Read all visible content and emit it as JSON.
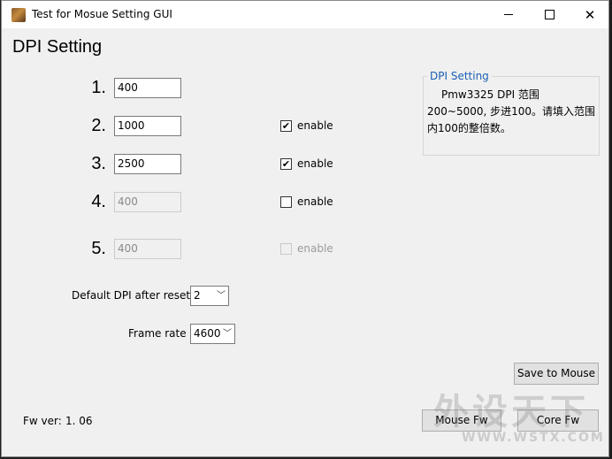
{
  "window": {
    "title": "Test for Mosue Setting GUI"
  },
  "heading": "DPI Setting",
  "dpi_rows": [
    {
      "num": "1.",
      "value": "400"
    },
    {
      "num": "2.",
      "value": "1000",
      "checkbox_label": "enable",
      "checked": true
    },
    {
      "num": "3.",
      "value": "2500",
      "checkbox_label": "enable",
      "checked": true
    },
    {
      "num": "4.",
      "value": "400",
      "checkbox_label": "enable",
      "checked": false
    },
    {
      "num": "5.",
      "value": "400",
      "checkbox_label": "enable",
      "checked": false
    }
  ],
  "default_dpi": {
    "label": "Default DPI after reset",
    "value": "2"
  },
  "frame_rate": {
    "label": "Frame rate",
    "value": "4600"
  },
  "info_group": {
    "title": "DPI Setting",
    "text": "Pmw3325 DPI 范围200~5000, 步进100。请填入范围内100的整倍数。"
  },
  "buttons": {
    "save": "Save to Mouse",
    "mouse_fw": "Mouse Fw",
    "core_fw": "Core Fw"
  },
  "fw_version": {
    "label": "Fw ver:",
    "value": "1. 06"
  },
  "watermark": {
    "text": "外设天下",
    "url": "WWW.WSTX.COM"
  }
}
